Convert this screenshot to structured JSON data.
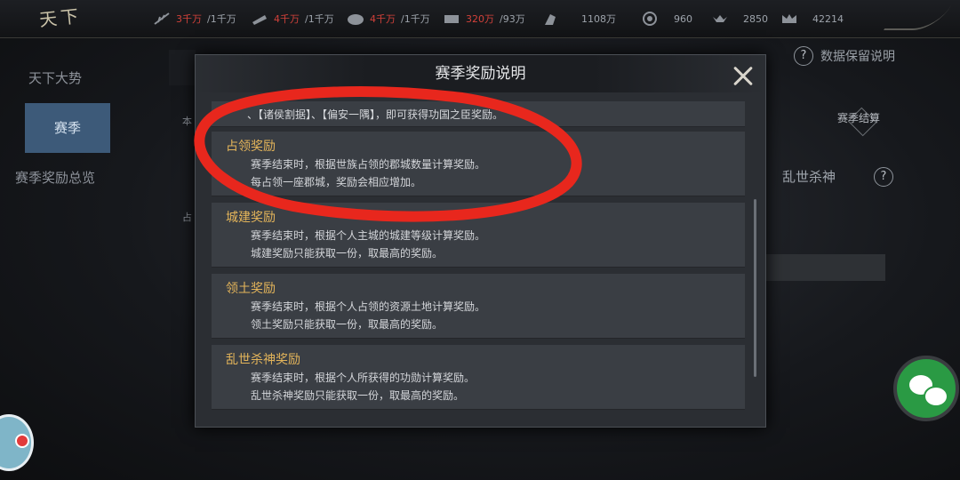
{
  "app": {
    "logo": "天下"
  },
  "resources": [
    {
      "icon": "feather-icon",
      "current": "3千万",
      "max": "/1千万"
    },
    {
      "icon": "wood-icon",
      "current": "4千万",
      "max": "/1千万"
    },
    {
      "icon": "stone-icon",
      "current": "4千万",
      "max": "/1千万"
    },
    {
      "icon": "iron-icon",
      "current": "320万",
      "max": "/93万"
    },
    {
      "icon": "horse-icon",
      "current": "1108万",
      "max": ""
    },
    {
      "icon": "coin-icon",
      "current": "960",
      "max": ""
    },
    {
      "icon": "ingot-icon",
      "current": "2850",
      "max": ""
    },
    {
      "icon": "crown-icon",
      "current": "42214",
      "max": ""
    }
  ],
  "nav": {
    "items": [
      "天下大势",
      "赛季",
      "赛季奖励总览"
    ],
    "active": 1
  },
  "background": {
    "help_label": "数据保留说明",
    "season_end": "赛季结算",
    "kill_label": "乱世杀神",
    "text_a": "本",
    "text_b": "占"
  },
  "modal": {
    "title": "赛季奖励说明",
    "partial_line": "、【诸侯割据】、【偏安一隅】，即可获得功国之臣奖励。",
    "sections": [
      {
        "title": "占领奖励",
        "lines": [
          "赛季结束时，根据世族占领的郡城数量计算奖励。",
          "每占领一座郡城，奖励会相应增加。"
        ]
      },
      {
        "title": "城建奖励",
        "lines": [
          "赛季结束时，根据个人主城的城建等级计算奖励。",
          "城建奖励只能获取一份，取最高的奖励。"
        ]
      },
      {
        "title": "领土奖励",
        "lines": [
          "赛季结束时，根据个人占领的资源土地计算奖励。",
          "领土奖励只能获取一份，取最高的奖励。"
        ]
      },
      {
        "title": "乱世杀神奖励",
        "lines": [
          "赛季结束时，根据个人所获得的功勋计算奖励。",
          "乱世杀神奖励只能获取一份，取最高的奖励。"
        ]
      }
    ]
  },
  "colors": {
    "accent_gold": "#e3b45a",
    "annotation_red": "#e8271d",
    "nav_active": "#3d5a79",
    "wechat_green": "#2a9a44"
  }
}
